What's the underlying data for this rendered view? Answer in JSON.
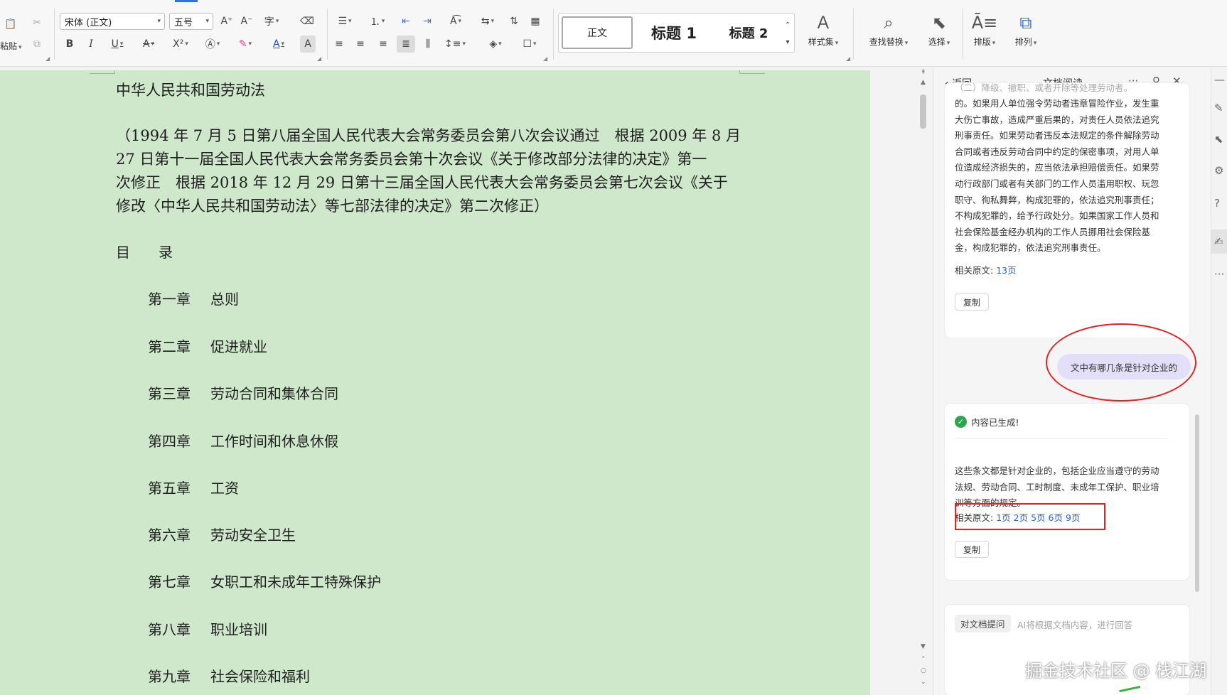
{
  "ribbon": {
    "paste_label": "粘贴",
    "font_name": "宋体 (正文)",
    "font_size": "五号",
    "style_gallery": {
      "normal": "正文",
      "heading1": "标题 1",
      "heading2": "标题 2"
    },
    "styles_set_label": "样式集",
    "find_replace_label": "查找替换",
    "select_label": "选择",
    "layout_label": "排版",
    "arrange_label": "排列"
  },
  "document": {
    "title": "中华人民共和国劳动法",
    "intro_lines": [
      "（1994 年 7 月 5 日第八届全国人民代表大会常务委员会第八次会议通过　根据 2009 年 8 月",
      "27 日第十一届全国人民代表大会常务委员会第十次会议《关于修改部分法律的决定》第一",
      "次修正　根据 2018 年 12 月 29 日第十三届全国人民代表大会常务委员会第七次会议《关于",
      "修改〈中华人民共和国劳动法〉等七部法律的决定》第二次修正）"
    ],
    "toc_heading": "目　　录",
    "chapters": [
      {
        "num": "第一章",
        "name": "总则"
      },
      {
        "num": "第二章",
        "name": "促进就业"
      },
      {
        "num": "第三章",
        "name": "劳动合同和集体合同"
      },
      {
        "num": "第四章",
        "name": "工作时间和休息休假"
      },
      {
        "num": "第五章",
        "name": "工资"
      },
      {
        "num": "第六章",
        "name": "劳动安全卫生"
      },
      {
        "num": "第七章",
        "name": "女职工和未成年工特殊保护"
      },
      {
        "num": "第八章",
        "name": "职业培训"
      },
      {
        "num": "第九章",
        "name": "社会保险和福利"
      }
    ]
  },
  "panel": {
    "back_label": "返回",
    "title": "文档阅读",
    "prev_answer": {
      "top_line": "（二）降级、撤职、或者开除等处理劳动者。",
      "lines": [
        "的。如果用人单位强令劳动者违章冒险作业，发生重",
        "大伤亡事故，造成严重后果的，对责任人员依法追究",
        "刑事责任。如果劳动者违反本法规定的条件解除劳动",
        "合同或者违反劳动合同中约定的保密事项，对用人单",
        "位造成经济损失的，应当依法承担赔偿责任。如果劳",
        "动行政部门或者有关部门的工作人员滥用职权、玩忽",
        "职守、徇私舞弊，构成犯罪的，依法追究刑事责任；",
        "不构成犯罪的，给予行政处分。如果国家工作人员和",
        "社会保险基金经办机构的工作人员挪用社会保险基",
        "金，构成犯罪的，依法追究刑事责任。"
      ],
      "ref_label": "相关原文: ",
      "ref_pages": [
        "13页"
      ],
      "copy_label": "复制"
    },
    "user_question": "文中有哪几条是针对企业的",
    "answer": {
      "status": "内容已生成!",
      "lines": [
        "这些条文都是针对企业的，包括企业应当遵守的劳动",
        "法规、劳动合同、工时制度、未成年工保护、职业培",
        "训等方面的规定。"
      ],
      "ref_label": "相关原文: ",
      "ref_pages": [
        "1页",
        "2页",
        "5页",
        "6页",
        "9页"
      ],
      "copy_label": "复制"
    },
    "ask": {
      "chip": "对文档提问",
      "placeholder": "AI将根据文档内容，进行回答"
    }
  },
  "watermark": "掘金技术社区 @ 栈江湖",
  "colors": {
    "page_bg": "#cfe8cc",
    "link": "#2b63c9",
    "annotation_red": "#e02424",
    "bubble": "#e4dff8"
  }
}
